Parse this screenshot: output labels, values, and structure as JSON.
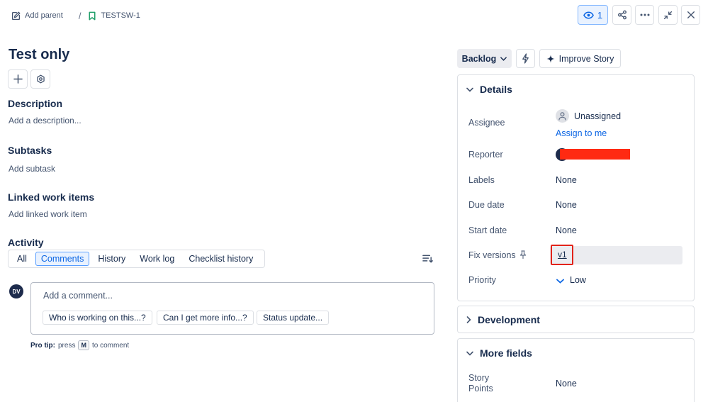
{
  "breadcrumb": {
    "add_parent": "Add parent",
    "separator": "/",
    "issue_key": "TESTSW-1"
  },
  "top_actions": {
    "watchers_count": "1",
    "icons": [
      "eye-icon",
      "share-icon",
      "more-icon",
      "minimize-icon",
      "close-icon"
    ]
  },
  "issue": {
    "title": "Test only",
    "description_heading": "Description",
    "description_placeholder": "Add a description...",
    "subtasks_heading": "Subtasks",
    "subtasks_placeholder": "Add subtask",
    "linked_heading": "Linked work items",
    "linked_placeholder": "Add linked work item"
  },
  "activity": {
    "heading": "Activity",
    "tabs": [
      "All",
      "Comments",
      "History",
      "Work log",
      "Checklist history"
    ],
    "active_tab": "Comments",
    "avatar_initials": "DV",
    "comment_placeholder": "Add a comment...",
    "suggestions": [
      "Who is working on this...?",
      "Can I get more info...?",
      "Status update..."
    ],
    "protip_bold": "Pro tip:",
    "protip_pre": "press",
    "protip_key": "M",
    "protip_post": "to comment"
  },
  "sidebar": {
    "status": "Backlog",
    "improve": "Improve Story",
    "details_heading": "Details",
    "fields": {
      "assignee_label": "Assignee",
      "assignee_value": "Unassigned",
      "assign_to_me": "Assign to me",
      "reporter_label": "Reporter",
      "labels_label": "Labels",
      "labels_value": "None",
      "due_label": "Due date",
      "due_value": "None",
      "start_label": "Start date",
      "start_value": "None",
      "fix_label": "Fix versions",
      "fix_value": "v1",
      "priority_label": "Priority",
      "priority_value": "Low"
    },
    "development_heading": "Development",
    "more_fields_heading": "More fields",
    "story_points_label_1": "Story",
    "story_points_label_2": "Points",
    "story_points_value": "None"
  },
  "colors": {
    "accent": "#0c66e4",
    "redaction": "#ff2a12",
    "highlight_box": "#e2231a",
    "issue_icon": "#22a06b"
  }
}
